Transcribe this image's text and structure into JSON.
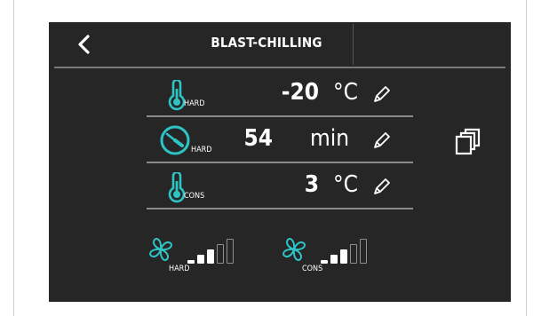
{
  "header": {
    "title": "BLAST-CHILLING",
    "back_icon": "chevron-left-icon"
  },
  "rows": [
    {
      "icon": "thermometer-icon",
      "sub_label": "HARD",
      "value": "-20",
      "unit": "°C",
      "edit_icon": "pencil-icon"
    },
    {
      "icon": "clock-icon",
      "sub_label": "HARD",
      "value": "54",
      "unit": "min",
      "edit_icon": "pencil-icon"
    },
    {
      "icon": "thermometer-icon",
      "sub_label": "CONS",
      "value": "3",
      "unit": "°C",
      "edit_icon": "pencil-icon"
    }
  ],
  "fans": [
    {
      "icon": "fan-icon",
      "sub_label": "HARD",
      "level": 3,
      "max_level": 5
    },
    {
      "icon": "fan-icon",
      "sub_label": "CONS",
      "level": 3,
      "max_level": 5
    }
  ],
  "side": {
    "copy_icon": "copy-icon"
  },
  "colors": {
    "accent": "#2ec4c6",
    "background": "#262626",
    "text": "#ffffff",
    "divider": "#8a8a8a"
  }
}
